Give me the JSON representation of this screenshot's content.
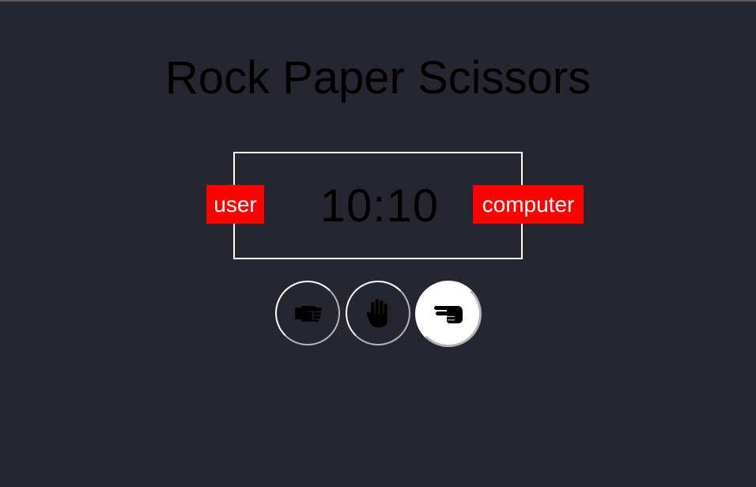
{
  "title": "Rock Paper Scissors",
  "scoreboard": {
    "user_label": "user",
    "computer_label": "computer",
    "score": "10:10"
  },
  "choices": [
    {
      "name": "rock",
      "icon": "fist-icon",
      "selected": false
    },
    {
      "name": "paper",
      "icon": "open-hand-icon",
      "selected": false
    },
    {
      "name": "scissors",
      "icon": "scissors-hand-icon",
      "selected": true
    }
  ],
  "colors": {
    "background": "#25262f",
    "badge": "#ff0000",
    "border": "#ffffff",
    "text": "#000000"
  }
}
